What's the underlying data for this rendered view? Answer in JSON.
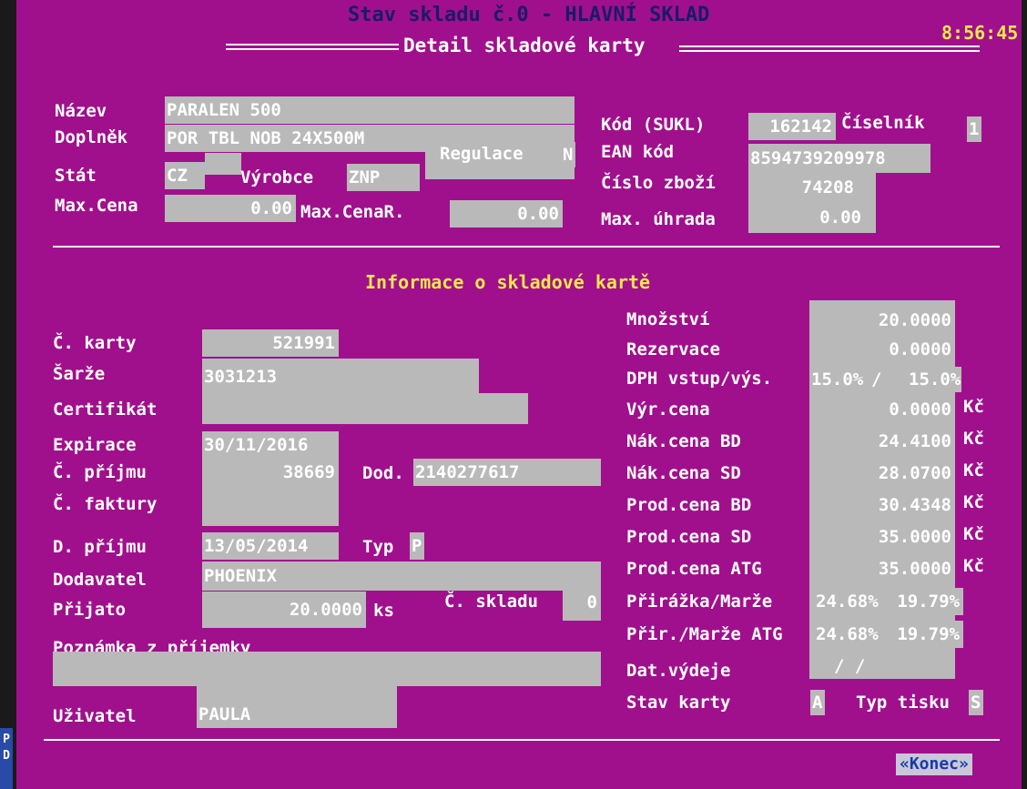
{
  "topbar": {
    "title": "Stav skladu č.0 - HLAVNÍ SKLAD",
    "clock": "8:56:45"
  },
  "window_title": "Detail skladové karty",
  "header": {
    "nazev_label": "Název",
    "nazev_value": "PARALEN 500",
    "doplnek_label": "Doplněk",
    "doplnek_value": "POR TBL NOB 24X500M",
    "regulace_label": "Regulace",
    "regulace_value": "N",
    "stat_label": "Stát",
    "stat_value": "CZ",
    "vyrobce_label": "Výrobce",
    "vyrobce_value": "ZNP",
    "maxcena_label": "Max.Cena",
    "maxcena_value": "0.00",
    "maxcenar_label": "Max.CenaR.",
    "maxcenar_value": "0.00",
    "kod_label": "Kód (SUKL)",
    "kod_value": "162142",
    "ciselnik_label": "Číselník",
    "ciselnik_value": "1",
    "ean_label": "EAN kód",
    "ean_value": "8594739209978",
    "cislo_label": "Číslo zboží",
    "cislo_value": "74208",
    "maxuhrada_label": "Max. úhrada",
    "maxuhrada_value": "0.00"
  },
  "section_title": "Informace o skladové kartě",
  "left": {
    "karty_label": "Č. karty",
    "karty_value": "521991",
    "sarze_label": "Šarže",
    "sarze_value": "3031213",
    "certifikat_label": "Certifikát",
    "certifikat_value": "",
    "expirace_label": "Expirace",
    "expirace_value": "30/11/2016",
    "prijmu_label": "Č. příjmu",
    "prijmu_value": "38669",
    "dod_label": "Dod.",
    "dod_value": "2140277617",
    "faktury_label": "Č. faktury",
    "faktury_value": "",
    "dprijmu_label": "D. příjmu",
    "dprijmu_value": "13/05/2014",
    "typ_label": "Typ",
    "typ_value": "P",
    "dodavatel_label": "Dodavatel",
    "dodavatel_value": "PHOENIX",
    "prijato_label": "Přijato",
    "prijato_value": "20.0000",
    "ks_label": "ks",
    "cskladu_label": "Č. skladu",
    "cskladu_value": "0",
    "poznamka_label": "Poznámka z příjemky",
    "poznamka_value": "",
    "uzivatel_label": "Uživatel",
    "uzivatel_value": "PAULA"
  },
  "right": {
    "mnozstvi_label": "Množství",
    "mnozstvi_value": "20.0000",
    "rezervace_label": "Rezervace",
    "rezervace_value": "0.0000",
    "dph_label": "DPH vstup/výs.",
    "dph_in": "15.0%",
    "dph_sep": "/",
    "dph_out": "15.0%",
    "vyrcena_label": "Výr.cena",
    "vyrcena_value": "0.0000",
    "vyrcena_cur": "Kč",
    "makbd_label": "Nák.cena BD",
    "makbd_value": "24.4100",
    "makbd_cur": "Kč",
    "maksd_label": "Nák.cena SD",
    "maksd_value": "28.0700",
    "maksd_cur": "Kč",
    "prodbd_label": "Prod.cena BD",
    "prodbd_value": "30.4348",
    "prodbd_cur": "Kč",
    "prodsd_label": "Prod.cena SD",
    "prodsd_value": "35.0000",
    "prodsd_cur": "Kč",
    "prodatg_label": "Prod.cena ATG",
    "prodatg_value": "35.0000",
    "prodatg_cur": "Kč",
    "prirazka_label": "Přirážka/Marže",
    "prirazka_value": "24.68%",
    "marze_value": "19.79%",
    "priratg_label": "Přir./Marže ATG",
    "priratg_value": "24.68%",
    "marzeatg_value": "19.79%",
    "datvydeje_label": "Dat.výdeje",
    "datvydeje_value": "/ /",
    "stavkarty_label": "Stav karty",
    "stavkarty_value": "A",
    "typtisku_label": "Typ tisku",
    "typtisku_value": "S"
  },
  "konec_label": "«Konec»",
  "side_letters": "P D"
}
